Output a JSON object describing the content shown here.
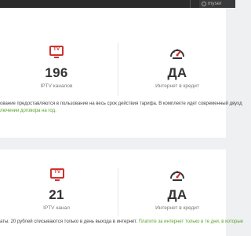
{
  "browser": {
    "search_text": "myser"
  },
  "section1": {
    "channels": {
      "value": "196",
      "label": "IPTV каналов"
    },
    "credit": {
      "value": "ДА",
      "label": "Интернет в кредит"
    },
    "desc_line1": "ование предоставляются в пользование на весь срок действия тарифа. В комплекте идет современный двухд",
    "desc_line2": "лючении договора на год."
  },
  "section2": {
    "channels": {
      "value": "21",
      "label": "IPTV канал"
    },
    "credit": {
      "value": "ДА",
      "label": "Интернет в кредит"
    },
    "desc_plain": "аты. 20 рублей списываются только в день выхода в интернет. ",
    "desc_green": "Платите за интернет только в те дни, в которые"
  },
  "icons": {
    "tv_text": "TV",
    "tv_icon": "tv-icon",
    "gauge_icon": "speedometer-icon",
    "accent": "#d0312d",
    "icon_dark": "#333333",
    "link_green": "#5aa12b"
  }
}
